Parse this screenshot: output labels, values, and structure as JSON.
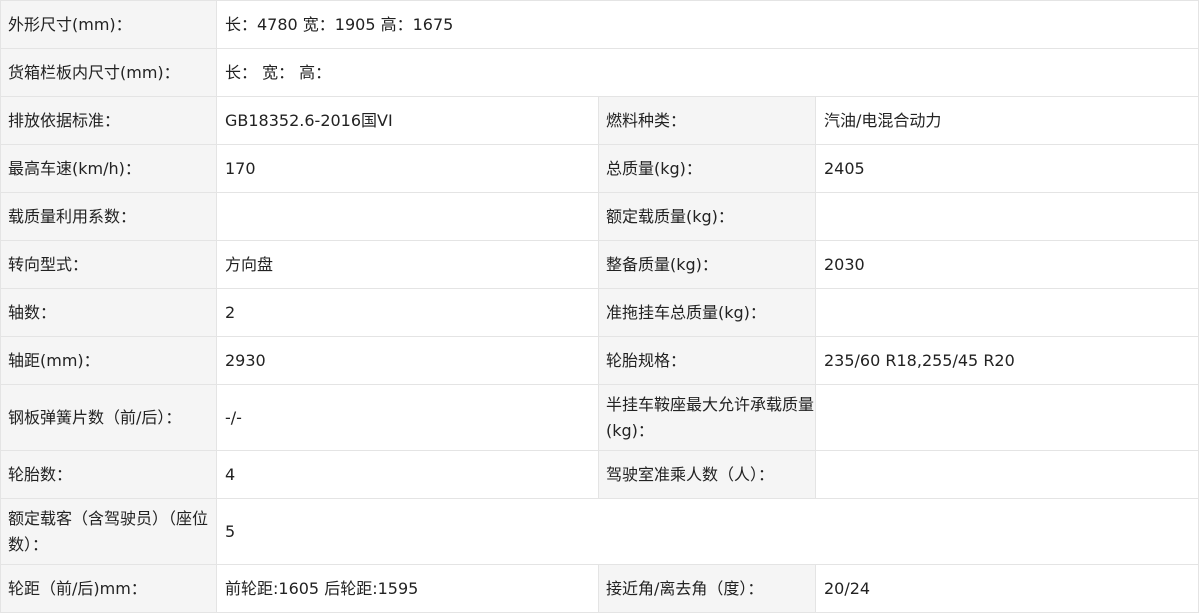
{
  "rows": [
    {
      "label": "外形尺寸(mm)：",
      "value": "长：4780 宽：1905 高：1675"
    },
    {
      "label": "货箱栏板内尺寸(mm)：",
      "value": "长： 宽： 高："
    },
    {
      "label": "排放依据标准：",
      "value": "GB18352.6-2016国VI",
      "label2": "燃料种类：",
      "value2": "汽油/电混合动力"
    },
    {
      "label": "最高车速(km/h)：",
      "value": "170",
      "label2": "总质量(kg)：",
      "value2": "2405"
    },
    {
      "label": "载质量利用系数：",
      "value": "",
      "label2": "额定载质量(kg)：",
      "value2": ""
    },
    {
      "label": "转向型式：",
      "value": "方向盘",
      "label2": "整备质量(kg)：",
      "value2": "2030"
    },
    {
      "label": "轴数：",
      "value": "2",
      "label2": "准拖挂车总质量(kg)：",
      "value2": ""
    },
    {
      "label": "轴距(mm)：",
      "value": "2930",
      "label2": "轮胎规格：",
      "value2": "235/60 R18,255/45 R20"
    },
    {
      "label": "钢板弹簧片数（前/后）：",
      "value": "-/-",
      "label2": "半挂车鞍座最大允许承载质量(kg)：",
      "value2": ""
    },
    {
      "label": "轮胎数：",
      "value": "4",
      "label2": "驾驶室准乘人数（人）：",
      "value2": ""
    },
    {
      "label": "额定载客（含驾驶员）（座位数）：",
      "value": "5"
    },
    {
      "label": "轮距（前/后)mm：",
      "value": "前轮距:1605 后轮距:1595",
      "label2": "接近角/离去角（度）：",
      "value2": "20/24"
    }
  ]
}
